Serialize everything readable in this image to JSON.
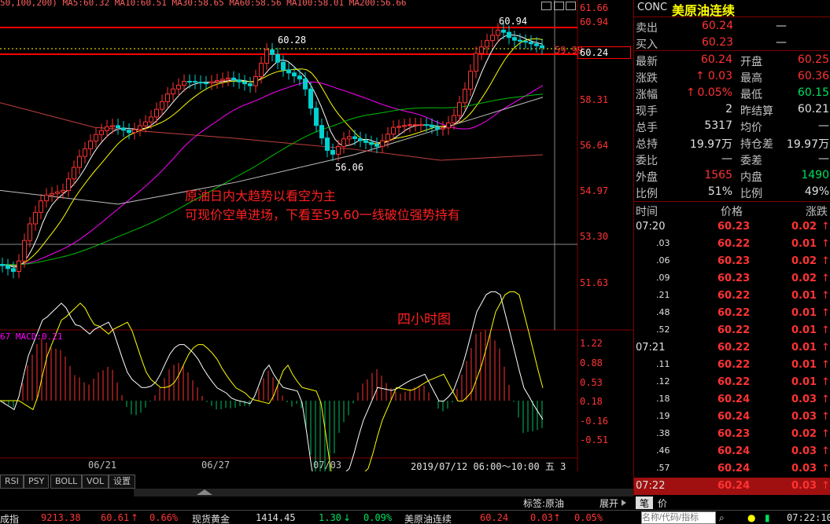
{
  "chart_header": {
    "ma_legend": "50,100,200) MA5:60.32 MA10:60.51 MA30:58.65 MA60:58.56 MA100:58.01 MA200:56.66",
    "macd_legend": "67  MACD:0.21"
  },
  "price_axis": [
    "61.66",
    "60.94",
    "59.99",
    "60.24",
    "58.31",
    "56.64",
    "54.97",
    "53.30",
    "51.63"
  ],
  "macd_axis": [
    "1.22",
    "0.88",
    "0.53",
    "0.18",
    "-0.16",
    "-0.51"
  ],
  "date_axis": [
    "06/21",
    "06/27",
    "07/03",
    "2019/07/12 06:00～10:00 五 3"
  ],
  "annotations": {
    "high_label": "60.94",
    "local_high_label": "60.28",
    "low_label": "56.06",
    "advice_line1": "原油日内大趋势以看空为主",
    "advice_line2": "可现价空单进场，下看至59.60一线破位强势持有",
    "chart_title": "四小时图"
  },
  "tabs": [
    "RSI",
    "PSY",
    "BOLL",
    "VOL",
    "设置"
  ],
  "colors": {
    "up_candle": "#ff3232",
    "down_candle": "#00d0d0",
    "ma5": "#ffffff",
    "ma10": "#ffff00",
    "ma30": "#ff00ff",
    "ma60": "#00c000",
    "ma100": "#c0c0c0",
    "ma200": "#c04040",
    "accent_red": "#ff0000"
  },
  "quote": {
    "code": "CONC",
    "name": "美原油连续",
    "sell_label": "卖出",
    "sell_price": "60.24",
    "sell_vol": "—",
    "buy_label": "买入",
    "buy_price": "60.23",
    "buy_vol": "—",
    "rows": [
      {
        "l1": "最新",
        "v1": "60.24",
        "l2": "开盘",
        "v2": "60.25",
        "c1": "red",
        "c2": "red"
      },
      {
        "l1": "涨跌",
        "v1": "0.03",
        "l2": "最高",
        "v2": "60.36",
        "c1": "red",
        "c2": "red"
      },
      {
        "l1": "涨幅",
        "v1": "0.05%",
        "l2": "最低",
        "v2": "60.15",
        "c1": "red",
        "c2": "green"
      },
      {
        "l1": "现手",
        "v1": "2",
        "l2": "昨结算",
        "v2": "60.21",
        "c1": "white",
        "c2": "white"
      },
      {
        "l1": "总手",
        "v1": "5317",
        "l2": "均价",
        "v2": "—",
        "c1": "white",
        "c2": "white"
      },
      {
        "l1": "总持",
        "v1": "19.97万",
        "l2": "持仓差",
        "v2": "19.97万",
        "c1": "white",
        "c2": "white"
      },
      {
        "l1": "委比",
        "v1": "—",
        "l2": "委差",
        "v2": "—",
        "c1": "white",
        "c2": "white"
      },
      {
        "l1": "外盘",
        "v1": "1565",
        "l2": "内盘",
        "v2": "1490",
        "c1": "red",
        "c2": "green"
      },
      {
        "l1": "比例",
        "v1": "51%",
        "l2": "比例",
        "v2": "49%",
        "c1": "white",
        "c2": "white"
      }
    ],
    "tick_header": {
      "time": "时间",
      "price": "价格",
      "change": "涨跌"
    },
    "ticks": [
      {
        "t": "07:20",
        "p": "60.23",
        "c": "0.02"
      },
      {
        "t": ".03",
        "p": "60.22",
        "c": "0.01"
      },
      {
        "t": ".06",
        "p": "60.23",
        "c": "0.02"
      },
      {
        "t": ".09",
        "p": "60.23",
        "c": "0.02"
      },
      {
        "t": ".21",
        "p": "60.22",
        "c": "0.01"
      },
      {
        "t": ".48",
        "p": "60.22",
        "c": "0.01"
      },
      {
        "t": ".52",
        "p": "60.22",
        "c": "0.01"
      },
      {
        "t": "07:21",
        "p": "60.22",
        "c": "0.01"
      },
      {
        "t": ".11",
        "p": "60.22",
        "c": "0.01"
      },
      {
        "t": ".12",
        "p": "60.22",
        "c": "0.01"
      },
      {
        "t": ".18",
        "p": "60.24",
        "c": "0.03"
      },
      {
        "t": ".19",
        "p": "60.24",
        "c": "0.03"
      },
      {
        "t": ".38",
        "p": "60.23",
        "c": "0.02"
      },
      {
        "t": ".46",
        "p": "60.24",
        "c": "0.03"
      },
      {
        "t": ".57",
        "p": "60.24",
        "c": "0.03"
      },
      {
        "t": "07:22",
        "p": "60.24",
        "c": "0.03"
      }
    ],
    "bottom_tabs": [
      "笔",
      "价"
    ],
    "tag_label": "标签:原油",
    "expand_label": "展开"
  },
  "status_bar": {
    "index_name": "成指",
    "index_value": "9213.38",
    "item1_value": "60.61",
    "item1_pct": "0.66%",
    "item2_name": "现货黄金",
    "item2_value": "1414.45",
    "item2_change": "1.30",
    "item2_pct": "0.09%",
    "item3_name": "美原油连续",
    "item3_value": "60.24",
    "item3_change": "0.03",
    "item3_pct": "0.05%",
    "search_placeholder": "名称/代码/指标",
    "clock": "07:22:10"
  }
}
